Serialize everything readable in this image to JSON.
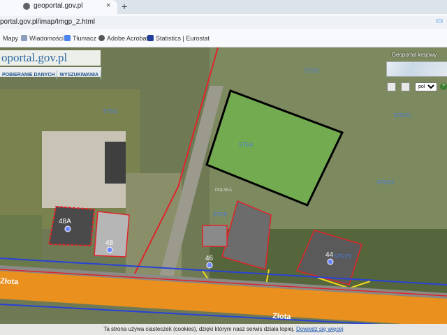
{
  "browser": {
    "tab_prefix": "s",
    "tab_title": "geoportal.gov.pl",
    "tab_close": "×",
    "new_tab": "+",
    "url": "portal.gov.pl/imap/Imgp_2.html",
    "bookmarks": [
      "Mapy",
      "Wiadomości",
      "Tłumacz",
      "Adobe Acrobat",
      "Statistics | Eurostat"
    ]
  },
  "geoportal": {
    "logo_left": "oportal",
    "logo_right": ".gov.pl",
    "menu": [
      "POBIERANIE DANYCH",
      "WYSZUKIWANIA"
    ],
    "overview_title": "Geoportal krajowy",
    "language": "pol"
  },
  "map": {
    "parcel_labels": [
      "575/2",
      "575/4",
      "575/3",
      "575/21",
      "575/22",
      "575/9",
      "575/23"
    ],
    "address_numbers": [
      "48A",
      "48",
      "46",
      "44"
    ],
    "street_name": "Złota",
    "area_label": "POLSKA"
  },
  "cookie_bar": {
    "text": "Ta strona używa ciasteczek (cookies), dzięki którym nasz serwis działa lepiej.",
    "link": "Dowiedz się więcej"
  },
  "colors": {
    "selected_parcel": "#6fb54b",
    "building_outline": "#e0242a",
    "network_blue": "#2742d8",
    "road": "#e9901f",
    "address_point": "#6f87ff"
  }
}
